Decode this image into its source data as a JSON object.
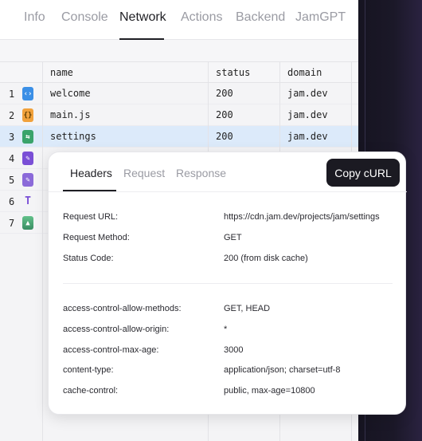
{
  "tabs": [
    "Info",
    "Console",
    "Network",
    "Actions",
    "Backend",
    "JamGPT"
  ],
  "active_tab": "Network",
  "table": {
    "columns": [
      "name",
      "status",
      "domain"
    ],
    "rows": [
      {
        "num": "1",
        "icon": "code-file-icon",
        "name": "welcome",
        "status": "200",
        "domain": "jam.dev"
      },
      {
        "num": "2",
        "icon": "json-file-icon",
        "name": "main.js",
        "status": "200",
        "domain": "jam.dev"
      },
      {
        "num": "3",
        "icon": "swap-file-icon",
        "name": "settings",
        "status": "200",
        "domain": "jam.dev"
      },
      {
        "num": "4",
        "icon": "pen-file-icon",
        "name": "",
        "status": "",
        "domain": ""
      },
      {
        "num": "5",
        "icon": "pen-file-icon",
        "name": "",
        "status": "",
        "domain": ""
      },
      {
        "num": "6",
        "icon": "font-file-icon",
        "name": "",
        "status": "",
        "domain": ""
      },
      {
        "num": "7",
        "icon": "image-file-icon",
        "name": "",
        "status": "",
        "domain": ""
      }
    ]
  },
  "popover": {
    "tabs": [
      "Headers",
      "Request",
      "Response"
    ],
    "active_tab": "Headers",
    "copy_label": "Copy cURL",
    "general": [
      {
        "key": "Request URL:",
        "value": "https://cdn.jam.dev/projects/jam/settings"
      },
      {
        "key": "Request Method:",
        "value": "GET"
      },
      {
        "key": "Status Code:",
        "value": "200 (from disk cache)"
      }
    ],
    "headers": [
      {
        "key": "access-control-allow-methods:",
        "value": "GET, HEAD"
      },
      {
        "key": "access-control-allow-origin:",
        "value": "*"
      },
      {
        "key": "access-control-max-age:",
        "value": "3000"
      },
      {
        "key": "content-type:",
        "value": "application/json; charset=utf-8"
      },
      {
        "key": "cache-control:",
        "value": "public, max-age=10800"
      }
    ]
  }
}
